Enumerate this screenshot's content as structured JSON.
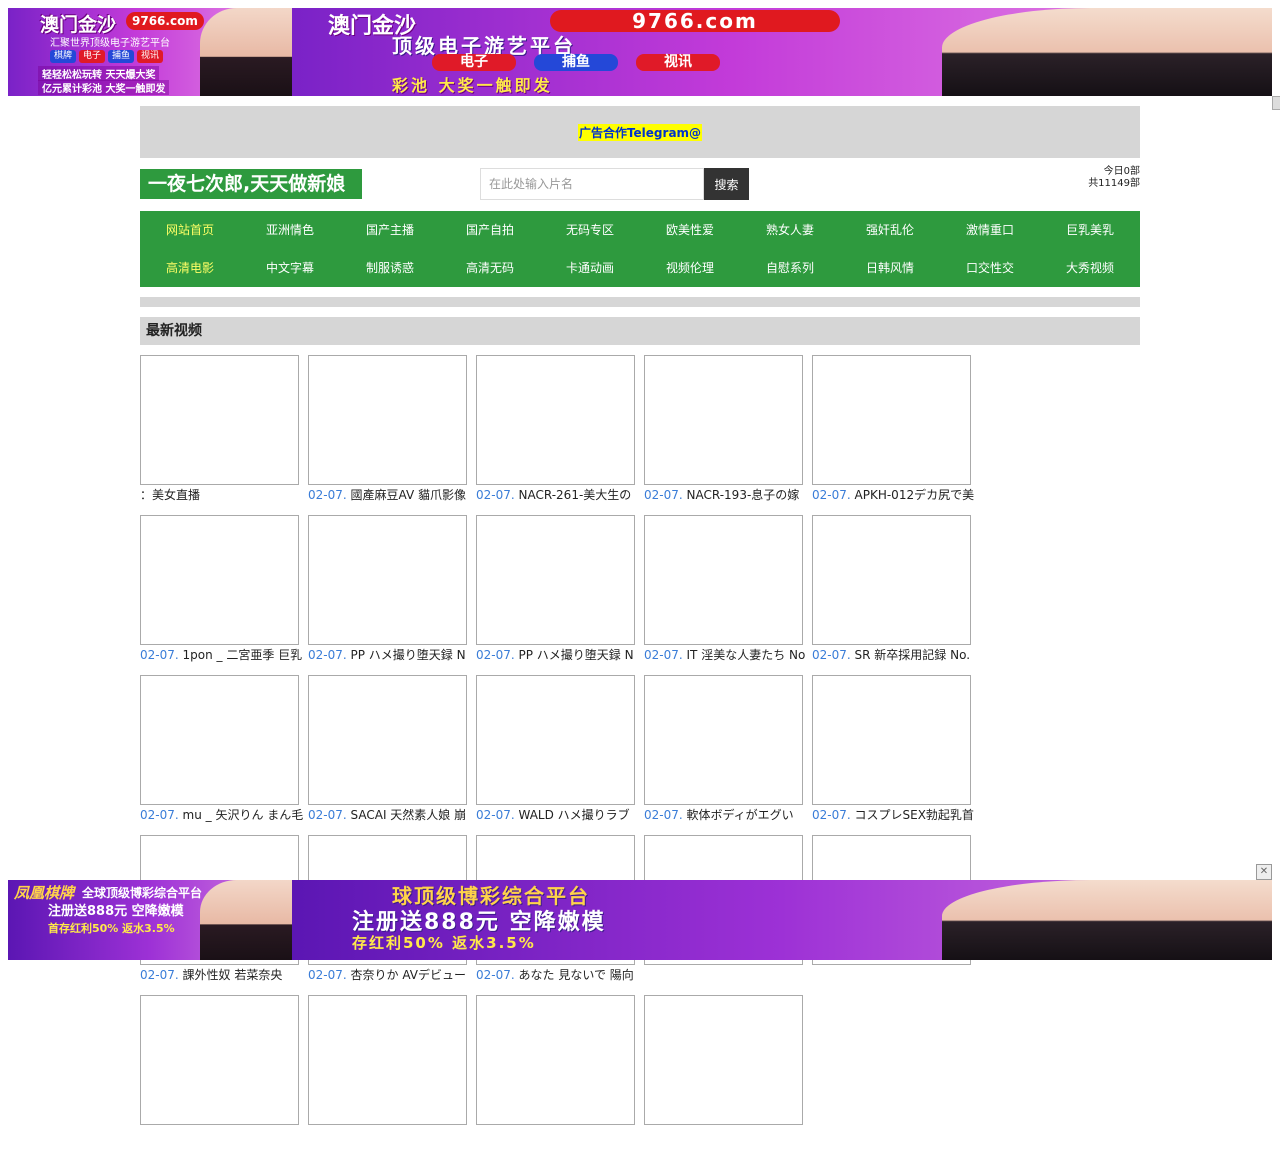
{
  "top_banner": {
    "small": {
      "brand": "澳门金沙",
      "domain": "9766.com",
      "subtitle": "汇聚世界顶级电子游艺平台",
      "chips": [
        "棋牌",
        "电子",
        "捕鱼",
        "视讯"
      ],
      "line1": "轻轻松松玩转 天天爆大奖",
      "line2": "亿元累计彩池 大奖一触即发"
    },
    "large": {
      "brand": "澳门金沙",
      "domain": "9766.com",
      "headline": "顶级电子游艺平台",
      "chips": [
        "电子",
        "捕鱼",
        "视讯"
      ],
      "slogan": "彩池 大奖一触即发"
    }
  },
  "bottom_banner": {
    "small": {
      "brand": "凤凰棋牌",
      "headline": "全球顶级博彩综合平台",
      "line2": "注册送888元 空降嫩模",
      "line3": "首存红利50% 返水3.5%"
    },
    "large": {
      "headline": "球顶级博彩综合平台",
      "line2": "注册送888元 空降嫩模",
      "line3": "存红利50% 返水3.5%"
    }
  },
  "ad_link": "广告合作Telegram@",
  "logo_text": "一夜七次郎,天天做新娘",
  "search": {
    "placeholder": "在此处输入片名",
    "button": "搜索"
  },
  "stats": {
    "today": "今日0部",
    "total": "共11149部"
  },
  "nav": {
    "row1": [
      {
        "label": "网站首页",
        "active": true
      },
      {
        "label": "亚洲情色"
      },
      {
        "label": "国产主播"
      },
      {
        "label": "国产自拍"
      },
      {
        "label": "无码专区"
      },
      {
        "label": "欧美性爱"
      },
      {
        "label": "熟女人妻"
      },
      {
        "label": "强奸乱伦"
      },
      {
        "label": "激情重口"
      },
      {
        "label": "巨乳美乳"
      }
    ],
    "row2": [
      {
        "label": "高清电影",
        "active": true
      },
      {
        "label": "中文字幕"
      },
      {
        "label": "制服诱惑"
      },
      {
        "label": "高清无码"
      },
      {
        "label": "卡通动画"
      },
      {
        "label": "视频伦理"
      },
      {
        "label": "自慰系列"
      },
      {
        "label": "日韩风情"
      },
      {
        "label": "口交性交"
      },
      {
        "label": "大秀视频"
      }
    ]
  },
  "section_title": "最新视频",
  "videos": [
    {
      "date": "",
      "title": "：美女直播"
    },
    {
      "date": "02-07.",
      "title": "國產麻豆AV 貓爪影像"
    },
    {
      "date": "02-07.",
      "title": "NACR-261-美大生の"
    },
    {
      "date": "02-07.",
      "title": "NACR-193-息子の嫁"
    },
    {
      "date": "02-07.",
      "title": "APKH-012デカ尻で美"
    },
    {
      "date": "02-07.",
      "title": "1pon _ 二宮亜季 巨乳"
    },
    {
      "date": "02-07.",
      "title": "PP ハメ撮り堕天録 N"
    },
    {
      "date": "02-07.",
      "title": "PP ハメ撮り堕天録 N"
    },
    {
      "date": "02-07.",
      "title": "IT 淫美な人妻たち No"
    },
    {
      "date": "02-07.",
      "title": "SR 新卒採用記録 No."
    },
    {
      "date": "02-07.",
      "title": "mu _ 矢沢りん まん毛"
    },
    {
      "date": "02-07.",
      "title": "SACAI 天然素人娘 崩"
    },
    {
      "date": "02-07.",
      "title": "WALD ハメ撮りラブ"
    },
    {
      "date": "02-07.",
      "title": "軟体ボディがエグい"
    },
    {
      "date": "02-07.",
      "title": "コスプレSEX勃起乳首"
    },
    {
      "date": "02-07.",
      "title": "課外性奴 若菜奈央"
    },
    {
      "date": "02-07.",
      "title": "杏奈りか AVデビュー"
    },
    {
      "date": "02-07.",
      "title": "あなた 見ないで 陽向"
    },
    {
      "date": "",
      "title": ""
    },
    {
      "date": "",
      "title": ""
    },
    {
      "date": "",
      "title": ""
    },
    {
      "date": "",
      "title": ""
    },
    {
      "date": "",
      "title": ""
    },
    {
      "date": "",
      "title": ""
    }
  ],
  "colors": {
    "green": "#2e9a3e",
    "gray": "#d6d6d6",
    "date_blue": "#3a7dd8",
    "highlight": "#ffff00"
  }
}
